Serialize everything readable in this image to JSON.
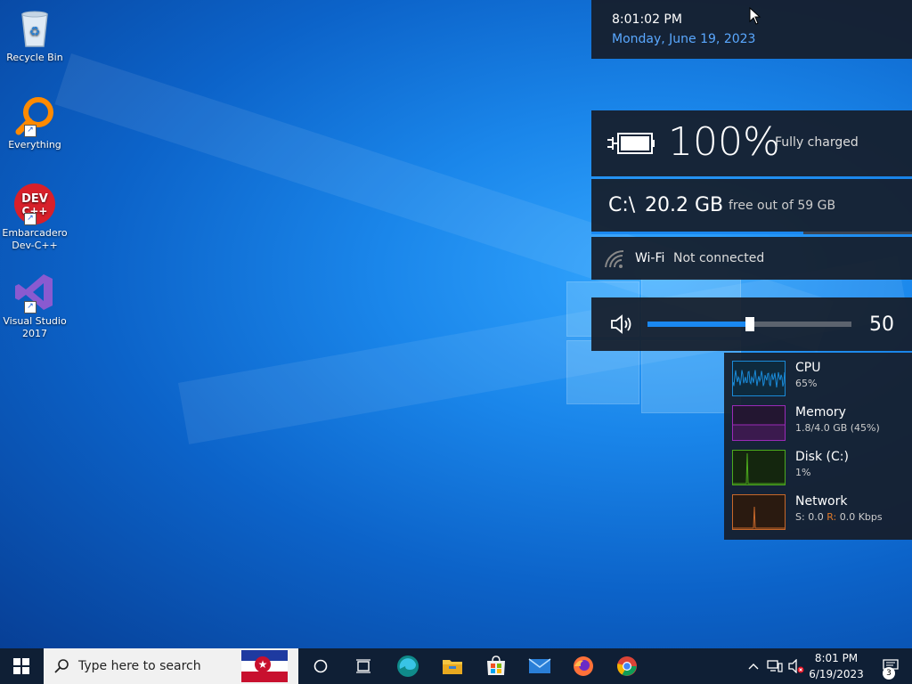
{
  "desktop_icons": [
    {
      "label": "Recycle Bin",
      "icon": "recycle-bin-icon"
    },
    {
      "label": "Everything",
      "icon": "everything-search-icon"
    },
    {
      "label": "Embarcadero Dev-C++",
      "icon": "devcpp-icon",
      "glyph_text": "DEV C++"
    },
    {
      "label": "Visual Studio 2017",
      "icon": "visual-studio-icon"
    }
  ],
  "clock": {
    "time": "8:01:02 PM",
    "date": "Monday, June 19, 2023"
  },
  "battery": {
    "percent": "100%",
    "status": "Fully charged",
    "level": 1.0
  },
  "disk": {
    "drive": "C:\\",
    "free": "20.2 GB",
    "total": "free out of 59 GB",
    "used_fraction": 0.66
  },
  "wifi": {
    "name": "Wi-Fi",
    "status": "Not connected"
  },
  "volume": {
    "value": "50",
    "level": 0.5
  },
  "performance": [
    {
      "name": "CPU",
      "value": "65%",
      "color": "#1a8ad8"
    },
    {
      "name": "Memory",
      "value": "1.8/4.0 GB (45%)",
      "color": "#9b2ab8"
    },
    {
      "name": "Disk (C:)",
      "value": "1%",
      "color": "#4caa1d"
    },
    {
      "name": "Network",
      "value_prefix_s": "S:",
      "value_s": "0.0",
      "value_prefix_r": "R:",
      "value_r": "0.0 Kbps",
      "color": "#c8682a"
    }
  ],
  "taskbar": {
    "search_placeholder": "Type here to search",
    "tray_time": "8:01 PM",
    "tray_date": "6/19/2023",
    "notification_count": "3"
  },
  "colors": {
    "accent": "#1a88f0",
    "panel": "#161c28",
    "taskbar": "#0f1f35"
  }
}
